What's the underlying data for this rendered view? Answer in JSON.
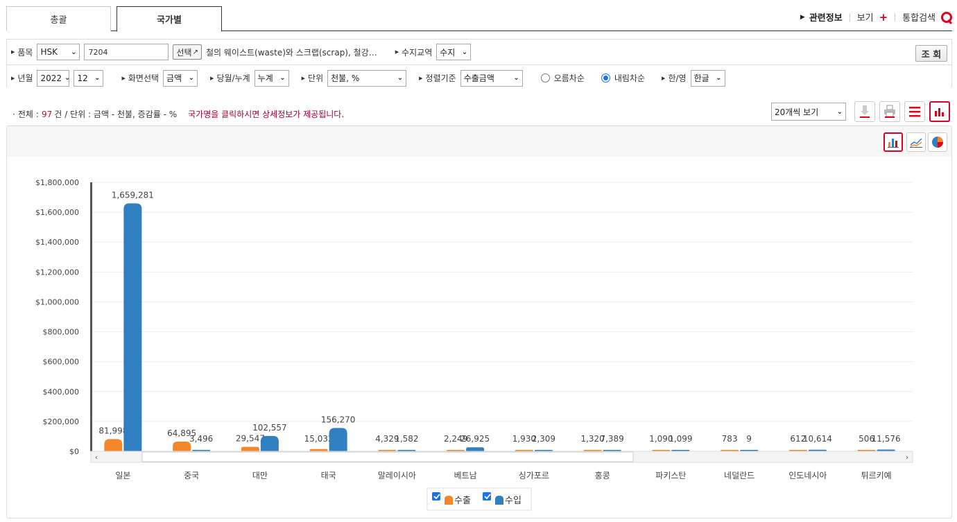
{
  "tabs": {
    "summary": "총괄",
    "by_country": "국가별"
  },
  "top_links": {
    "related": "관련정보",
    "view": "보기",
    "plus": "+",
    "search": "통합검색"
  },
  "filters": {
    "item_label": "품목",
    "item_type": "HSK",
    "item_code": "7204",
    "select_button": "선택",
    "item_desc": "철의 웨이스트(waste)와 스크랩(scrap), 철강…",
    "trade_label": "수지교역",
    "trade_value": "수지",
    "query_button": "조 회",
    "year_label": "년월",
    "year": "2022",
    "month": "12",
    "screen_label": "화면선택",
    "screen_value": "금액",
    "period_label": "당월/누계",
    "period_value": "누계",
    "unit_label": "단위",
    "unit_value": "천불, %",
    "sort_label": "정렬기준",
    "sort_value": "수출금액",
    "asc_label": "오름차순",
    "desc_label": "내림차순",
    "lang_label": "한/영",
    "lang_value": "한글"
  },
  "summary": {
    "total_prefix": "전체",
    "total_count": "97",
    "total_suffix": "건",
    "unit_text": "/ 단위 : 금액 - 천불, 증감률 - %",
    "note": "국가명을 클릭하시면 상세정보가 제공됩니다.",
    "page_size": "20개씩 보기"
  },
  "colors": {
    "export": "#f5862b",
    "import": "#2f7fc1",
    "accent": "#d6002a"
  },
  "chart_data": {
    "type": "bar",
    "categories": [
      "일본",
      "중국",
      "대만",
      "태국",
      "말레이시아",
      "베트남",
      "싱가포르",
      "홍콩",
      "파키스탄",
      "네덜란드",
      "인도네시아",
      "튀르키예"
    ],
    "series": [
      {
        "name": "수출",
        "values": [
          81998,
          64895,
          29547,
          15032,
          4329,
          2249,
          1930,
          1320,
          1090,
          783,
          612,
          506
        ],
        "labels": [
          "81,998",
          "64,895",
          "29,547",
          "15,032",
          "4,329",
          "2,249",
          "1,930",
          "1,320",
          "1,090",
          "783",
          "612",
          "506"
        ]
      },
      {
        "name": "수입",
        "values": [
          1659281,
          3496,
          102557,
          156270,
          1582,
          26925,
          2309,
          7389,
          1099,
          9,
          10614,
          11576
        ],
        "labels": [
          "1,659,281",
          "3,496",
          "102,557",
          "156,270",
          "1,582",
          "26,925",
          "2,309",
          "7,389",
          "1,099",
          "9",
          "10,614",
          "11,576"
        ]
      }
    ],
    "yticks": [
      "$0",
      "$200,000",
      "$400,000",
      "$600,000",
      "$800,000",
      "$1,000,000",
      "$1,200,000",
      "$1,400,000",
      "$1,600,000",
      "$1,800,000"
    ],
    "ylim": [
      0,
      1800000
    ],
    "legend_position": "bottom-center"
  }
}
